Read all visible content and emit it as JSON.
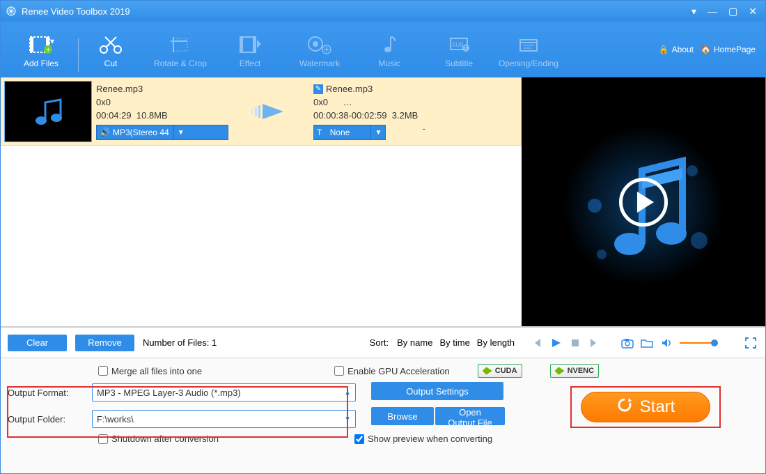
{
  "titlebar": {
    "title": "Renee Video Toolbox 2019"
  },
  "toolbar": {
    "add_files": "Add Files",
    "cut": "Cut",
    "rotate_crop": "Rotate & Crop",
    "effect": "Effect",
    "watermark": "Watermark",
    "music": "Music",
    "subtitle": "Subtitle",
    "opening_ending": "Opening/Ending",
    "about": "About",
    "homepage": "HomePage"
  },
  "file": {
    "src_name": "Renee.mp3",
    "src_dim": "0x0",
    "src_dur": "00:04:29",
    "src_size": "10.8MB",
    "audio_sel": "MP3(Stereo 44",
    "sub_sel": "None",
    "dst_name": "Renee.mp3",
    "dst_dim": "0x0",
    "dst_dots": "…",
    "dst_range": "00:00:38-00:02:59",
    "dst_size": "3.2MB",
    "dash": "-"
  },
  "listbar": {
    "clear": "Clear",
    "remove": "Remove",
    "count_label": "Number of Files:  1",
    "sort_label": "Sort:",
    "by_name": "By name",
    "by_time": "By time",
    "by_length": "By length"
  },
  "bottom": {
    "merge": "Merge all files into one",
    "gpu": "Enable GPU Acceleration",
    "cuda": "CUDA",
    "nvenc": "NVENC",
    "out_format_label": "Output Format:",
    "out_format_value": "MP3 - MPEG Layer-3 Audio (*.mp3)",
    "out_folder_label": "Output Folder:",
    "out_folder_value": "F:\\works\\",
    "output_settings": "Output Settings",
    "browse": "Browse",
    "open_output": "Open Output File",
    "shutdown": "Shutdown after conversion",
    "show_preview": "Show preview when converting",
    "start": "Start"
  }
}
